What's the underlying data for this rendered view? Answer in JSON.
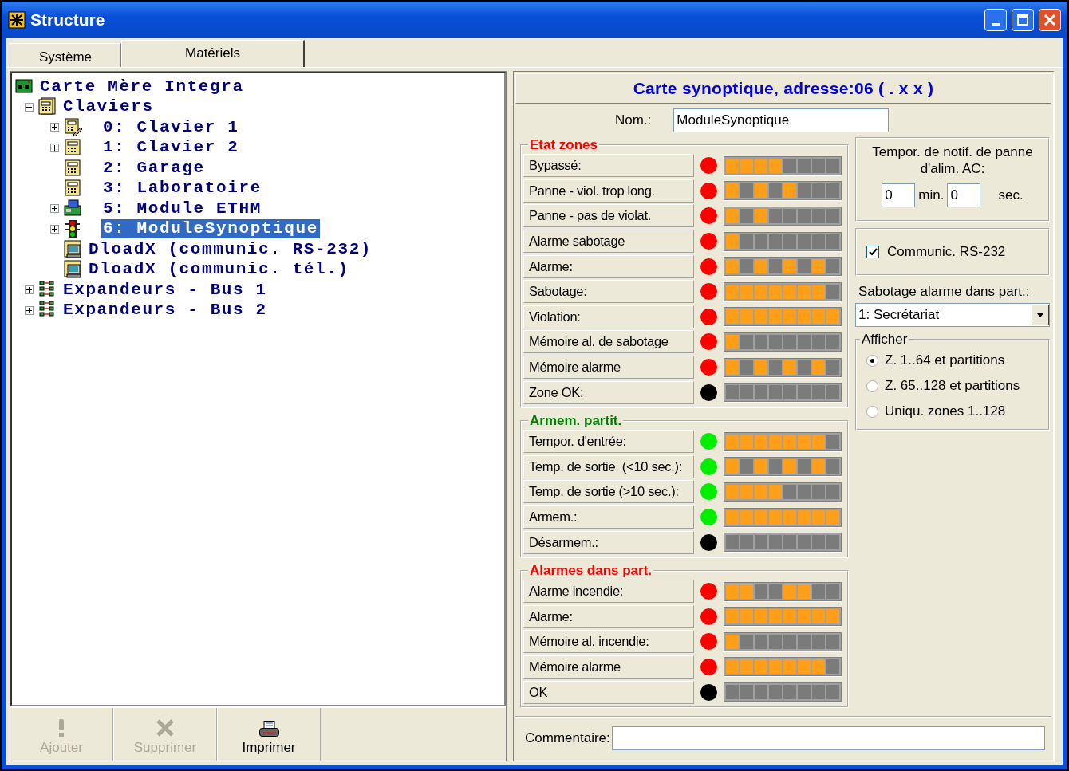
{
  "window": {
    "title": "Structure"
  },
  "tabs": [
    {
      "label": "Système",
      "selected": false
    },
    {
      "label": "Matériels",
      "selected": true
    }
  ],
  "tree": [
    {
      "label": "Carte Mère Integra",
      "kind": "board",
      "selected": false,
      "children": [
        {
          "label": "Claviers",
          "kind": "keypads",
          "expanded": true,
          "selected": false,
          "children": [
            {
              "label": "0: Clavier 1",
              "kind": "keypad-edit",
              "expanded": false,
              "selected": false
            },
            {
              "label": "1: Clavier 2",
              "kind": "keypad",
              "expanded": false,
              "selected": false
            },
            {
              "label": "2: Garage",
              "kind": "keypad",
              "selected": false
            },
            {
              "label": "3: Laboratoire",
              "kind": "keypad",
              "selected": false
            },
            {
              "label": "5: Module ETHM",
              "kind": "ethm",
              "expanded": false,
              "selected": false
            },
            {
              "label": "6: ModuleSynoptique",
              "kind": "synoptic",
              "expanded": false,
              "selected": true
            },
            {
              "label": "DloadX (communic. RS-232)",
              "kind": "computer",
              "selected": false
            },
            {
              "label": "DloadX (communic. tél.)",
              "kind": "computer",
              "selected": false
            }
          ]
        },
        {
          "label": "Expandeurs - Bus 1",
          "kind": "expander",
          "expanded": false,
          "selected": false
        },
        {
          "label": "Expandeurs - Bus 2",
          "kind": "expander",
          "expanded": false,
          "selected": false
        }
      ]
    }
  ],
  "toolbar": [
    {
      "label": "Ajouter",
      "disabled": true
    },
    {
      "label": "Supprimer",
      "disabled": true
    },
    {
      "label": "Imprimer",
      "disabled": false
    }
  ],
  "panel": {
    "title": "Carte synoptique, adresse:06 ( . x x )",
    "name_label": "Nom.:",
    "name_value": "ModuleSynoptique",
    "groups": [
      {
        "title": "Etat zones",
        "color": "#ff0000",
        "rows": [
          {
            "label": "Bypassé:",
            "color": "#ff0000",
            "lit": [
              true,
              true,
              true,
              true,
              false,
              false,
              false,
              false
            ]
          },
          {
            "label": "Panne - viol. trop long.",
            "color": "#ff0000",
            "lit": [
              true,
              false,
              true,
              false,
              true,
              false,
              false,
              false
            ]
          },
          {
            "label": "Panne - pas de violat.",
            "color": "#ff0000",
            "lit": [
              true,
              false,
              true,
              false,
              false,
              false,
              false,
              false
            ]
          },
          {
            "label": "Alarme sabotage",
            "color": "#ff0000",
            "lit": [
              true,
              false,
              false,
              false,
              false,
              false,
              false,
              false
            ]
          },
          {
            "label": "Alarme:",
            "color": "#ff0000",
            "lit": [
              true,
              false,
              true,
              false,
              true,
              false,
              true,
              false
            ]
          },
          {
            "label": "Sabotage:",
            "color": "#ff0000",
            "lit": [
              true,
              true,
              true,
              true,
              true,
              true,
              true,
              false
            ]
          },
          {
            "label": "Violation:",
            "color": "#ff0000",
            "lit": [
              true,
              true,
              true,
              true,
              true,
              true,
              true,
              true
            ]
          },
          {
            "label": "Mémoire al. de sabotage",
            "color": "#ff0000",
            "lit": [
              true,
              false,
              false,
              false,
              false,
              false,
              false,
              false
            ]
          },
          {
            "label": "Mémoire alarme",
            "color": "#ff0000",
            "lit": [
              true,
              false,
              true,
              false,
              true,
              false,
              true,
              false
            ]
          },
          {
            "label": "Zone OK:",
            "color": "#000000",
            "lit": [
              false,
              false,
              false,
              false,
              false,
              false,
              false,
              false
            ]
          }
        ]
      },
      {
        "title": "Armem. partit.",
        "color": "#008000",
        "rows": [
          {
            "label": "Tempor. d'entrée:",
            "color": "#00ee00",
            "lit": [
              true,
              true,
              true,
              true,
              true,
              true,
              true,
              false
            ]
          },
          {
            "label": "Temp. de sortie  (<10 sec.):",
            "color": "#00ee00",
            "lit": [
              true,
              false,
              true,
              false,
              true,
              false,
              true,
              false
            ]
          },
          {
            "label": "Temp. de sortie (>10 sec.):",
            "color": "#00ee00",
            "lit": [
              true,
              true,
              true,
              true,
              false,
              false,
              false,
              false
            ]
          },
          {
            "label": "Armem.:",
            "color": "#00ee00",
            "lit": [
              true,
              true,
              true,
              true,
              true,
              true,
              true,
              true
            ]
          },
          {
            "label": "Désarmem.:",
            "color": "#000000",
            "lit": [
              false,
              false,
              false,
              false,
              false,
              false,
              false,
              false
            ]
          }
        ]
      },
      {
        "title": "Alarmes dans part.",
        "color": "#ff0000",
        "rows": [
          {
            "label": "Alarme incendie:",
            "color": "#ff0000",
            "lit": [
              true,
              true,
              false,
              false,
              true,
              true,
              false,
              false
            ]
          },
          {
            "label": "Alarme:",
            "color": "#ff0000",
            "lit": [
              true,
              true,
              true,
              true,
              true,
              true,
              true,
              true
            ]
          },
          {
            "label": "Mémoire al. incendie:",
            "color": "#ff0000",
            "lit": [
              true,
              false,
              false,
              false,
              false,
              false,
              false,
              false
            ]
          },
          {
            "label": "Mémoire alarme",
            "color": "#ff0000",
            "lit": [
              true,
              true,
              true,
              true,
              true,
              true,
              true,
              false
            ]
          },
          {
            "label": "OK",
            "color": "#000000",
            "lit": [
              false,
              false,
              false,
              false,
              false,
              false,
              false,
              false
            ]
          }
        ]
      }
    ],
    "ac_delay": {
      "label": "Tempor. de notif. de panne d'alim. AC:",
      "minutes": "0",
      "min_unit": "min.",
      "seconds": "0",
      "sec_unit": "sec."
    },
    "rs232": {
      "label": "Communic. RS-232",
      "checked": true
    },
    "tamper_partition": {
      "label": "Sabotage alarme dans part.:",
      "value": "1: Secrétariat"
    },
    "display": {
      "title": "Afficher",
      "options": [
        {
          "label": "Z. 1..64 et partitions",
          "selected": true
        },
        {
          "label": "Z. 65..128 et partitions",
          "selected": false
        },
        {
          "label": "Uniqu. zones 1..128",
          "selected": false
        }
      ]
    },
    "comment": {
      "label": "Commentaire:"
    }
  }
}
